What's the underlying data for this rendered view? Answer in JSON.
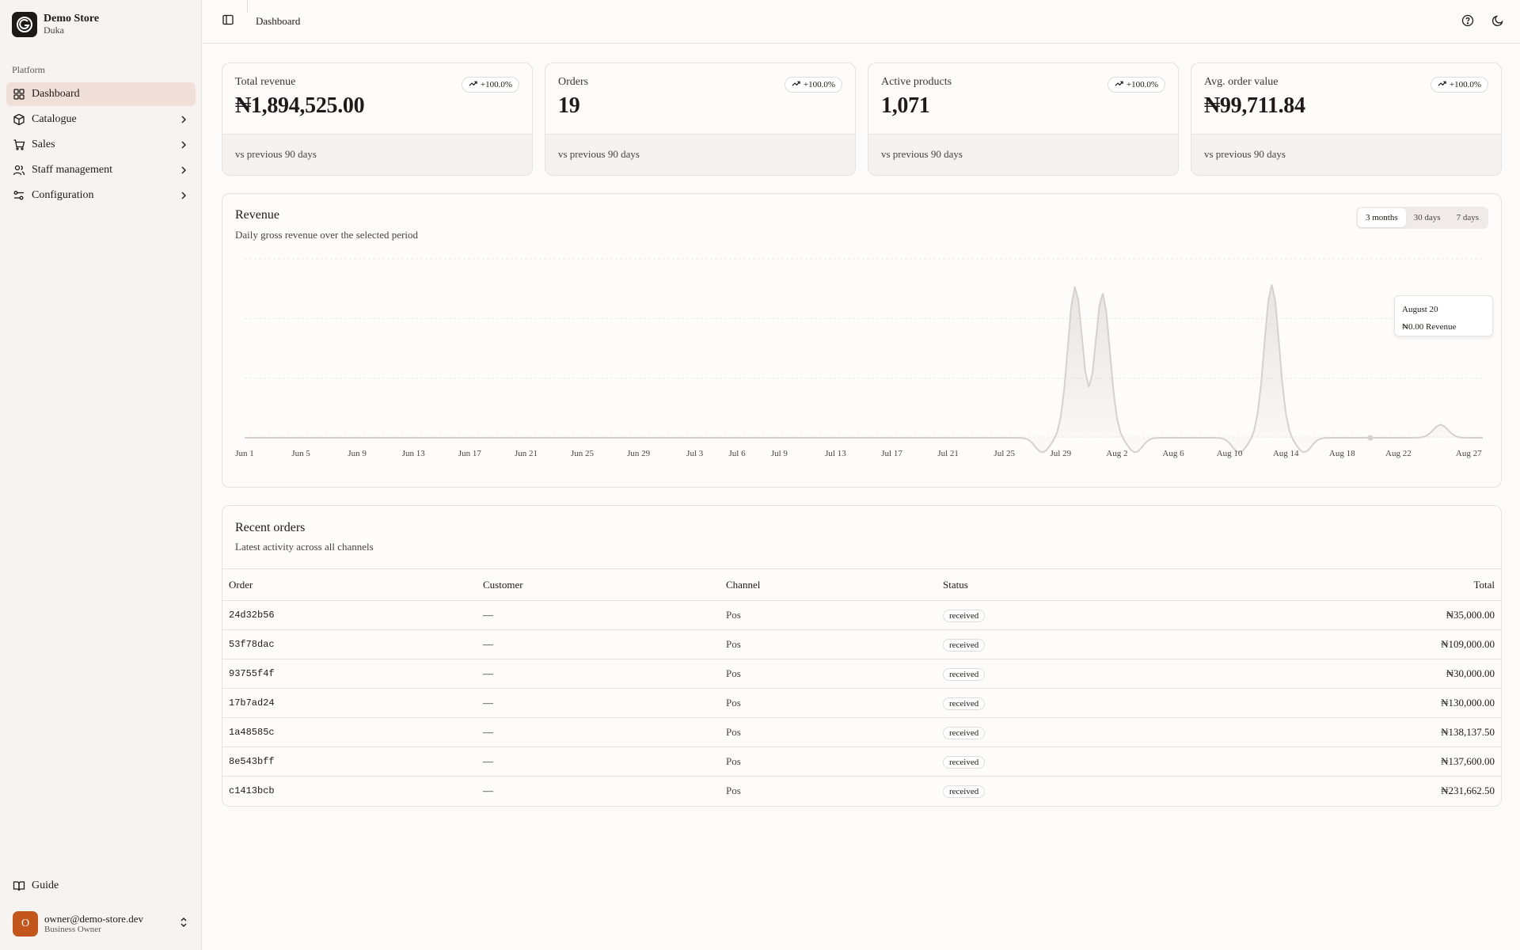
{
  "brand": {
    "name": "Demo Store",
    "sub": "Duka"
  },
  "sidebar": {
    "section_label": "Platform",
    "items": [
      {
        "label": "Dashboard",
        "icon": "dashboard-icon",
        "active": true,
        "has_children": false
      },
      {
        "label": "Catalogue",
        "icon": "box-icon",
        "active": false,
        "has_children": true
      },
      {
        "label": "Sales",
        "icon": "cart-icon",
        "active": false,
        "has_children": true
      },
      {
        "label": "Staff management",
        "icon": "users-icon",
        "active": false,
        "has_children": true
      },
      {
        "label": "Configuration",
        "icon": "sliders-icon",
        "active": false,
        "has_children": true
      }
    ],
    "guide_label": "Guide",
    "user": {
      "initial": "O",
      "email": "owner@demo-store.dev",
      "role": "Business Owner"
    }
  },
  "topbar": {
    "breadcrumb": "Dashboard"
  },
  "stats": [
    {
      "title": "Total revenue",
      "value": "₦1,894,525.00",
      "change": "+100.0%",
      "footer": "vs previous 90 days"
    },
    {
      "title": "Orders",
      "value": "19",
      "change": "+100.0%",
      "footer": "vs previous 90 days"
    },
    {
      "title": "Active products",
      "value": "1,071",
      "change": "+100.0%",
      "footer": "vs previous 90 days"
    },
    {
      "title": "Avg. order value",
      "value": "₦99,711.84",
      "change": "+100.0%",
      "footer": "vs previous 90 days"
    }
  ],
  "revenue": {
    "title": "Revenue",
    "subtitle": "Daily gross revenue over the selected period",
    "ranges": [
      "3 months",
      "30 days",
      "7 days"
    ],
    "active_range": "3 months",
    "tooltip": {
      "date": "August 20",
      "value": "₦0.00 Revenue"
    }
  },
  "chart_data": {
    "type": "area",
    "x_ticks": [
      "Jun 1",
      "Jun 5",
      "Jun 9",
      "Jun 13",
      "Jun 17",
      "Jun 21",
      "Jun 25",
      "Jun 29",
      "Jul 3",
      "Jul 6",
      "Jul 9",
      "Jul 13",
      "Jul 17",
      "Jul 21",
      "Jul 25",
      "Jul 29",
      "Aug 2",
      "Aug 6",
      "Aug 10",
      "Aug 14",
      "Aug 18",
      "Aug 22",
      "Aug 27"
    ],
    "peaks": [
      {
        "date": "Jul 30",
        "relative_value": 1.0
      },
      {
        "date": "Aug 1",
        "relative_value": 0.96
      },
      {
        "date": "Aug 13",
        "relative_value": 0.94
      },
      {
        "date": "Aug 25",
        "relative_value": 0.08
      }
    ],
    "grid": true,
    "color": "#d6d1ce"
  },
  "orders": {
    "title": "Recent orders",
    "subtitle": "Latest activity across all channels",
    "columns": [
      "Order",
      "Customer",
      "Channel",
      "Status",
      "Total"
    ],
    "rows": [
      {
        "id": "24d32b56",
        "customer": "—",
        "channel": "Pos",
        "status": "received",
        "total": "₦35,000.00"
      },
      {
        "id": "53f78dac",
        "customer": "—",
        "channel": "Pos",
        "status": "received",
        "total": "₦109,000.00"
      },
      {
        "id": "93755f4f",
        "customer": "—",
        "channel": "Pos",
        "status": "received",
        "total": "₦30,000.00"
      },
      {
        "id": "17b7ad24",
        "customer": "—",
        "channel": "Pos",
        "status": "received",
        "total": "₦130,000.00"
      },
      {
        "id": "1a48585c",
        "customer": "—",
        "channel": "Pos",
        "status": "received",
        "total": "₦138,137.50"
      },
      {
        "id": "8e543bff",
        "customer": "—",
        "channel": "Pos",
        "status": "received",
        "total": "₦137,600.00"
      },
      {
        "id": "c1413bcb",
        "customer": "—",
        "channel": "Pos",
        "status": "received",
        "total": "₦231,662.50"
      }
    ]
  }
}
